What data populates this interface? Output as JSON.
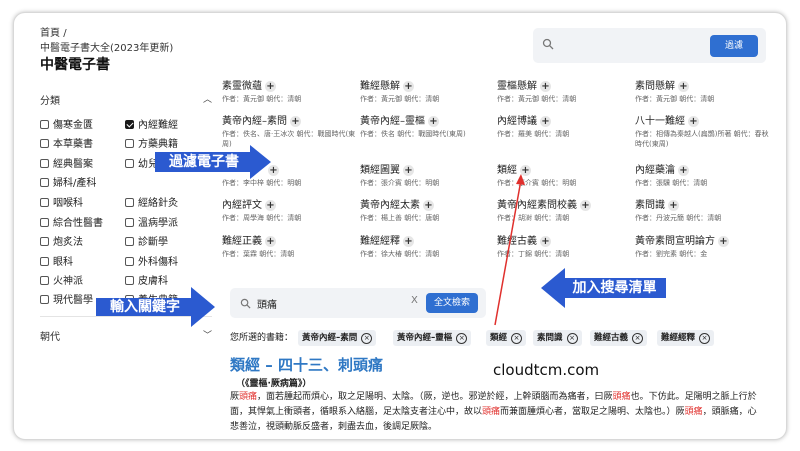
{
  "breadcrumb": {
    "home": "首頁",
    "sep": "/",
    "current": "中醫電子書大全(2023年更新)"
  },
  "page_title": "中醫電子書",
  "search": {
    "button_label": "過濾"
  },
  "filter": {
    "category_label": "分類",
    "dynasty_label": "朝代",
    "categories": [
      {
        "label": "傷寒金匱",
        "checked": false
      },
      {
        "label": "內經難經",
        "checked": true
      },
      {
        "label": "本草藥書",
        "checked": false
      },
      {
        "label": "方藥典籍",
        "checked": false
      },
      {
        "label": "經典醫案",
        "checked": false
      },
      {
        "label": "幼兒",
        "checked": false
      },
      {
        "label": "婦科/產科",
        "checked": false
      },
      {
        "label": "",
        "checked": false
      },
      {
        "label": "咽喉科",
        "checked": false
      },
      {
        "label": "經絡針灸",
        "checked": false
      },
      {
        "label": "綜合性醫書",
        "checked": false
      },
      {
        "label": "溫病學派",
        "checked": false
      },
      {
        "label": "炮炙法",
        "checked": false
      },
      {
        "label": "診斷學",
        "checked": false
      },
      {
        "label": "眼科",
        "checked": false
      },
      {
        "label": "外科傷科",
        "checked": false
      },
      {
        "label": "火神派",
        "checked": false
      },
      {
        "label": "皮膚科",
        "checked": false
      },
      {
        "label": "現代醫學",
        "checked": false
      },
      {
        "label": "養生典籍",
        "checked": false
      }
    ]
  },
  "books": [
    {
      "title": "素靈微蘊",
      "meta": "作者：黃元御 朝代：清朝"
    },
    {
      "title": "難經懸解",
      "meta": "作者：黃元御 朝代：清朝"
    },
    {
      "title": "靈樞懸解",
      "meta": "作者：黃元御 朝代：清朝"
    },
    {
      "title": "素問懸解",
      "meta": "作者：黃元御 朝代：清朝"
    },
    {
      "title": "黃帝內經–素問",
      "meta": "作者：佚名、唐·王冰次 朝代：戰國時代(東周)"
    },
    {
      "title": "黃帝內經–靈樞",
      "meta": "作者：佚名 朝代：戰國時代(東周)"
    },
    {
      "title": "內經博議",
      "meta": "作者：羅美 朝代：清朝"
    },
    {
      "title": "八十一難經",
      "meta": "作者：相傳為秦越人(扁鵲)所著 朝代：春秋時代(東周)"
    },
    {
      "title": "",
      "meta": "作者：李中梓 朝代：明朝"
    },
    {
      "title": "類經圖翼",
      "meta": "作者：張介賓 朝代：明朝"
    },
    {
      "title": "類經",
      "meta": "作者：張介賓 朝代：明朝"
    },
    {
      "title": "內經藥瀹",
      "meta": "作者：張驥 朝代：清朝"
    },
    {
      "title": "內經評文",
      "meta": "作者：周學海 朝代：清朝"
    },
    {
      "title": "黃帝內經太素",
      "meta": "作者：楊上善 朝代：唐朝"
    },
    {
      "title": "黃帝內經素問校義",
      "meta": "作者：胡澍 朝代：清朝"
    },
    {
      "title": "素問識",
      "meta": "作者：丹波元簡 朝代：清朝"
    },
    {
      "title": "難經正義",
      "meta": "作者：葉霖 朝代：清朝"
    },
    {
      "title": "難經經釋",
      "meta": "作者：徐大椿 朝代：清朝"
    },
    {
      "title": "難經古義",
      "meta": "作者：丁錦 朝代：清朝"
    },
    {
      "title": "黃帝素問宣明論方",
      "meta": "作者：劉完素 朝代：金"
    }
  ],
  "keyword": {
    "value": "頭痛",
    "clear": "X",
    "button_label": "全文檢索"
  },
  "selected": {
    "label": "您所選的書籍：",
    "chips": [
      {
        "label": "黃帝內經–素問",
        "remove": "×"
      },
      {
        "label": "黃帝內經–靈樞",
        "remove": "×"
      },
      {
        "label": "類經",
        "remove": "×"
      },
      {
        "label": "素問識",
        "remove": "×"
      },
      {
        "label": "難經古義",
        "remove": "×"
      },
      {
        "label": "難經經釋",
        "remove": "×"
      }
    ]
  },
  "result": {
    "title": "類經 – 四十三、刺頭痛",
    "subtitle": "（《靈樞·厥病篇》）",
    "body": {
      "p1a": "厥",
      "p1b": "頭痛",
      "p1c": "，面若腫起而煩心，取之足陽明、太陰。（厥，逆也。邪逆於經，上幹頭腦而為痛者，曰厥",
      "p1d": "頭痛",
      "p1e": "也。下仿此。足陽明之脈上行於面，其悍氣上衝頭者，循眼系入絡腦，足太陰支者注心中，故以",
      "p1f": "頭痛",
      "p1g": "而兼面腫煩心者，當取足之陽明、太陰也。）厥",
      "p1h": "頭痛",
      "p1i": "，頭脈痛，心悲善泣，視頭動脈反盛者，刺盡去血，後調足厥陰。"
    }
  },
  "brand": "cloudtcm.com",
  "annotations": {
    "filter_books": "過濾電子書",
    "enter_keyword": "輸入關鍵字",
    "add_to_list": "加入搜尋清單"
  },
  "colors": {
    "accent": "#2f6fd1",
    "highlight": "#e0302d",
    "annotation": "#2b5ad0",
    "arrow": "#e0302d"
  }
}
